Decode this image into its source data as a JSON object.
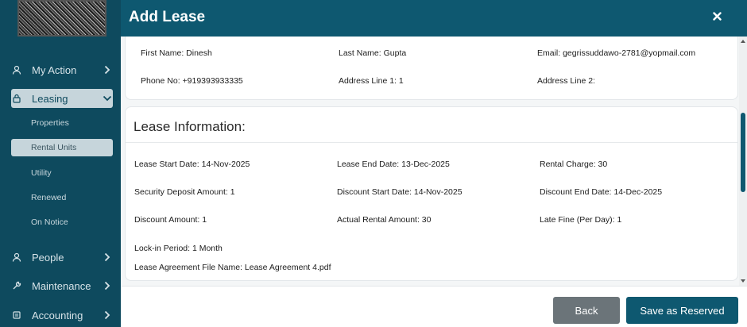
{
  "sidebar": {
    "items": [
      {
        "label": "My Action",
        "icon": "person-icon"
      },
      {
        "label": "Leasing",
        "icon": "lock-icon",
        "expanded": true
      },
      {
        "label": "People",
        "icon": "people-icon"
      },
      {
        "label": "Maintenance",
        "icon": "wrench-icon"
      },
      {
        "label": "Accounting",
        "icon": "ledger-icon"
      }
    ],
    "leasing_subitems": [
      {
        "label": "Properties"
      },
      {
        "label": "Rental Units",
        "active": true
      },
      {
        "label": "Utility"
      },
      {
        "label": "Renewed"
      },
      {
        "label": "On Notice"
      }
    ]
  },
  "modal": {
    "title": "Add Lease",
    "tenant": {
      "first_name": "First Name: Dinesh",
      "last_name": "Last Name: Gupta",
      "email": "Email: gegrissuddawo-2781@yopmail.com",
      "phone": "Phone No: +919393933335",
      "address1": "Address Line 1: 1",
      "address2": "Address Line 2:"
    },
    "lease": {
      "section_title": "Lease Information:",
      "start_date": "Lease Start Date: 14-Nov-2025",
      "end_date": "Lease End Date: 13-Dec-2025",
      "rental_charge": "Rental Charge: 30",
      "security_deposit": "Security Deposit Amount: 1",
      "discount_start": "Discount Start Date: 14-Nov-2025",
      "discount_end": "Discount End Date: 14-Dec-2025",
      "discount_amount": "Discount Amount: 1",
      "actual_rental": "Actual Rental Amount: 30",
      "late_fine": "Late Fine (Per Day): 1",
      "lock_in": "Lock-in Period: 1 Month",
      "agreement_file": "Lease Agreement File Name:  Lease Agreement 4.pdf"
    },
    "footer": {
      "back_label": "Back",
      "save_label": "Save as Reserved"
    }
  },
  "colors": {
    "sidebar_bg": "#0e4a5e",
    "header_bg": "#0e5870",
    "back_button": "#6b7479",
    "primary_button": "#0e5870"
  }
}
